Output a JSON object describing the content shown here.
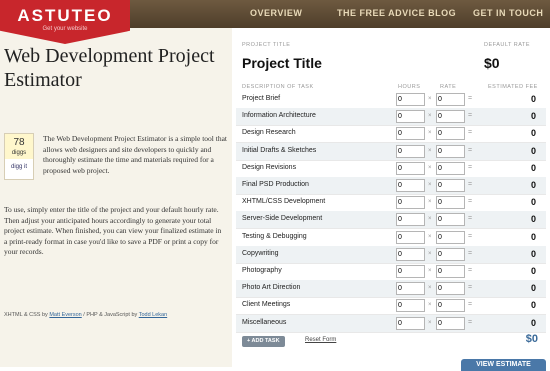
{
  "brand": {
    "name": "ASTUTEO",
    "tagline": "Get your website"
  },
  "nav": [
    "OVERVIEW",
    "THE FREE ADVICE BLOG",
    "GET IN TOUCH"
  ],
  "left": {
    "title": "Web Development Project Estimator",
    "digg": {
      "count": "78",
      "unit": "diggs",
      "action": "digg it"
    },
    "intro": "The Web Development Project Estimator is a simple tool that allows web designers and site developers to quickly and thoroughly estimate the time and materials required for a proposed web project.",
    "para2": "To use, simply enter the title of the project and your default hourly rate. Then adjust your anticipated hours accordingly to generate your total project estimate. When finished, you can view your finalized estimate in a print-ready format in case you'd like to save a PDF or print a copy for your records.",
    "credits": {
      "prefix": "XHTML & CSS by ",
      "author1": "Matt Everson",
      "middle": " / PHP & JavaScript by ",
      "author2": "Todd Lekan"
    }
  },
  "form": {
    "project_title_label": "PROJECT TITLE",
    "project_title": "Project Title",
    "default_rate_label": "DEFAULT RATE",
    "default_rate": "$0",
    "headers": {
      "task": "DESCRIPTION OF TASK",
      "hours": "HOURS",
      "rate": "RATE",
      "fee": "ESTIMATED FEE"
    },
    "tasks": [
      {
        "name": "Project Brief",
        "hours": "0",
        "rate": "0",
        "fee": "0"
      },
      {
        "name": "Information Architecture",
        "hours": "0",
        "rate": "0",
        "fee": "0"
      },
      {
        "name": "Design Research",
        "hours": "0",
        "rate": "0",
        "fee": "0"
      },
      {
        "name": "Initial Drafts & Sketches",
        "hours": "0",
        "rate": "0",
        "fee": "0"
      },
      {
        "name": "Design Revisions",
        "hours": "0",
        "rate": "0",
        "fee": "0"
      },
      {
        "name": "Final PSD Production",
        "hours": "0",
        "rate": "0",
        "fee": "0"
      },
      {
        "name": "XHTML/CSS Development",
        "hours": "0",
        "rate": "0",
        "fee": "0"
      },
      {
        "name": "Server-Side Development",
        "hours": "0",
        "rate": "0",
        "fee": "0"
      },
      {
        "name": "Testing & Debugging",
        "hours": "0",
        "rate": "0",
        "fee": "0"
      },
      {
        "name": "Copywriting",
        "hours": "0",
        "rate": "0",
        "fee": "0"
      },
      {
        "name": "Photography",
        "hours": "0",
        "rate": "0",
        "fee": "0"
      },
      {
        "name": "Photo Art Direction",
        "hours": "0",
        "rate": "0",
        "fee": "0"
      },
      {
        "name": "Client Meetings",
        "hours": "0",
        "rate": "0",
        "fee": "0"
      },
      {
        "name": "Miscellaneous",
        "hours": "0",
        "rate": "0",
        "fee": "0"
      }
    ],
    "times_symbol": "×",
    "equals_symbol": "=",
    "add_task_label": "+ ADD TASK",
    "reset_label": "Reset Form",
    "total": "$0",
    "view_estimate_label": "VIEW ESTIMATE"
  },
  "colors": {
    "brand_red": "#c8262c",
    "topbar": "#5a4832",
    "link_blue": "#336699",
    "alt_row": "#eef2f4"
  }
}
